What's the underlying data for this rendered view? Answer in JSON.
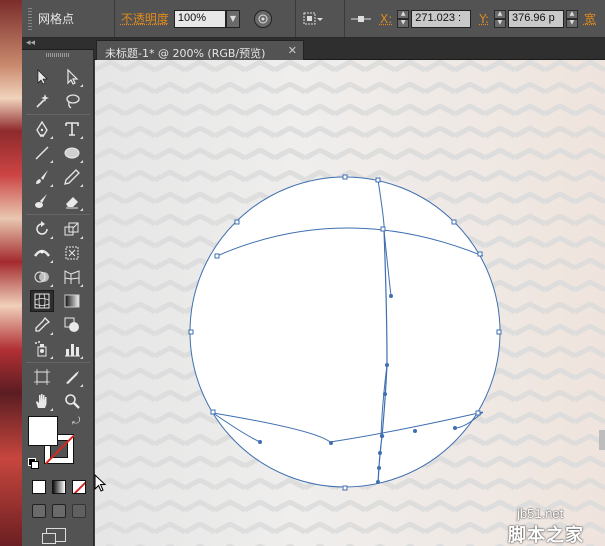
{
  "control_bar": {
    "tool_name": "网格点",
    "opacity_label": "不透明度",
    "opacity_value": "100%",
    "x_label": "X:",
    "x_value": "271.023 :",
    "y_label": "Y:",
    "y_value": "376.96 p",
    "width_label": "宽"
  },
  "tools_header": {
    "collapse_glyph": "◂◂"
  },
  "document": {
    "tab_title": "未标题-1* @ 200% (RGB/预览)",
    "close_glyph": "✕"
  },
  "tools": [
    "selection-tool",
    "direct-selection-tool",
    "magic-wand-tool",
    "lasso-tool",
    "pen-tool",
    "type-tool",
    "line-segment-tool",
    "ellipse-tool",
    "paintbrush-tool",
    "pencil-tool",
    "blob-brush-tool",
    "eraser-tool",
    "rotate-tool",
    "scale-tool",
    "width-tool",
    "free-transform-tool",
    "shape-builder-tool",
    "perspective-grid-tool",
    "mesh-tool",
    "gradient-tool",
    "eyedropper-tool",
    "blend-tool",
    "symbol-sprayer-tool",
    "column-graph-tool",
    "artboard-tool",
    "slice-tool",
    "hand-tool",
    "zoom-tool"
  ],
  "colors": {
    "mesh_stroke": "#3f6fb0",
    "accent_orange": "#e08a1e",
    "none_red": "#d8271f"
  },
  "watermark": {
    "url": "jb51.net",
    "site": "脚本之家"
  }
}
